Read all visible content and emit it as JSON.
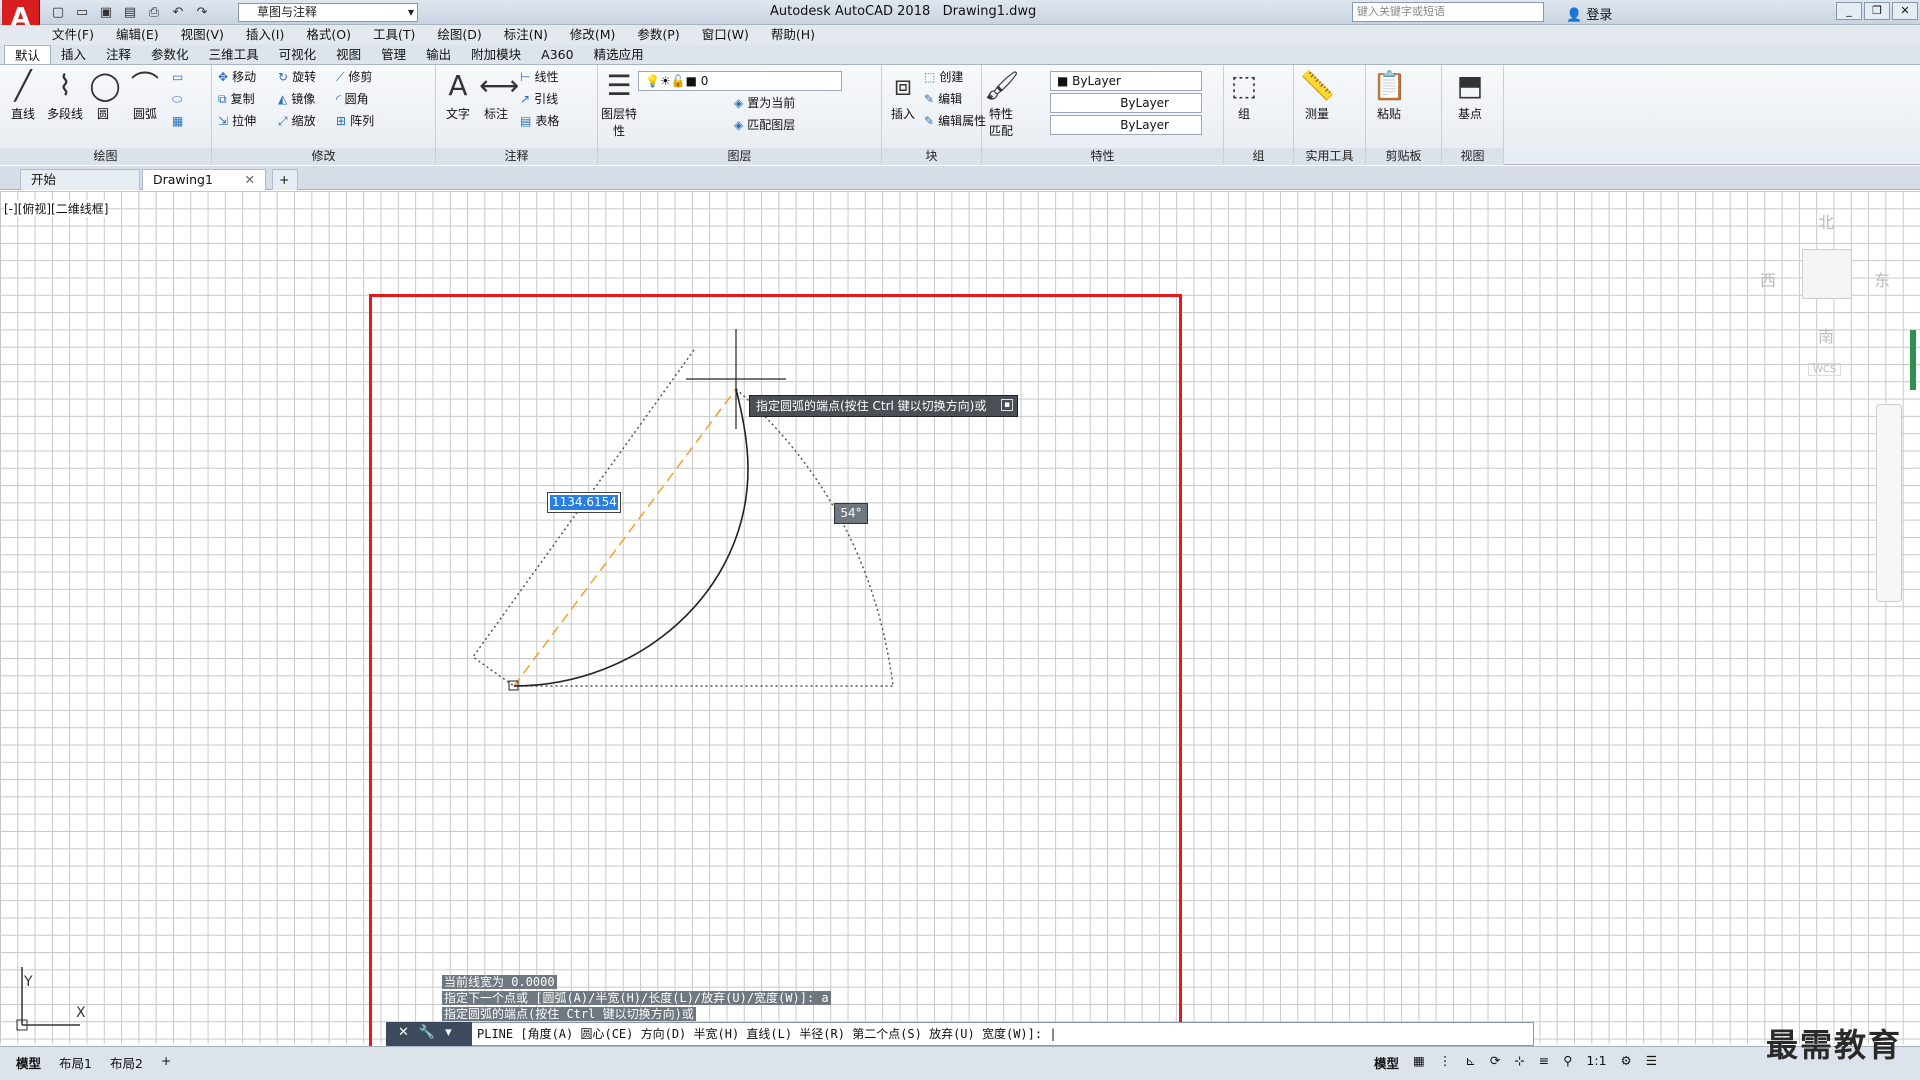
{
  "app": {
    "logo": "A",
    "title": "Autodesk AutoCAD 2018",
    "document": "Drawing1.dwg",
    "workspace": "草图与注释",
    "search_placeholder": "键入关键字或短语",
    "login": "登录"
  },
  "menu": [
    "文件(F)",
    "编辑(E)",
    "视图(V)",
    "插入(I)",
    "格式(O)",
    "工具(T)",
    "绘图(D)",
    "标注(N)",
    "修改(M)",
    "参数(P)",
    "窗口(W)",
    "帮助(H)"
  ],
  "ribbon_tabs": [
    "默认",
    "插入",
    "注释",
    "参数化",
    "三维工具",
    "可视化",
    "视图",
    "管理",
    "输出",
    "附加模块",
    "A360",
    "精选应用"
  ],
  "panels": {
    "draw": {
      "title": "绘图",
      "tools": [
        "直线",
        "多段线",
        "圆",
        "圆弧"
      ]
    },
    "modify": {
      "title": "修改",
      "tools": [
        "移动",
        "旋转",
        "修剪",
        "复制",
        "镜像",
        "圆角",
        "拉伸",
        "缩放",
        "阵列"
      ]
    },
    "annotation": {
      "title": "注释",
      "tools": [
        "文字",
        "标注",
        "线性",
        "引线",
        "表格"
      ]
    },
    "layers": {
      "title": "图层",
      "tools": [
        "图层特性",
        "置为当前",
        "匹配图层"
      ],
      "current": "0"
    },
    "block": {
      "title": "块",
      "tools": [
        "插入",
        "创建",
        "编辑",
        "编辑属性"
      ]
    },
    "properties": {
      "title": "特性",
      "match": "特性匹配",
      "color": "ByLayer",
      "linetype": "ByLayer",
      "lineweight": "ByLayer"
    },
    "groups": {
      "title": "组",
      "tool": "组"
    },
    "utilities": {
      "title": "实用工具",
      "tool": "测量"
    },
    "clipboard": {
      "title": "剪贴板",
      "tool": "粘贴"
    },
    "view": {
      "title": "视图",
      "tool": "基点"
    }
  },
  "doc_tabs": [
    "开始",
    "Drawing1"
  ],
  "viewport_label": "[-][俯视][二维线框]",
  "viewcube": {
    "north": "北",
    "south": "南",
    "east": "东",
    "west": "西",
    "wcs": "WCS"
  },
  "tooltip": "指定圆弧的端点(按住 Ctrl 键以切换方向)或",
  "dynamic_input": "1134.6154",
  "angle_label": "54°",
  "command_history": [
    "当前线宽为 0.0000",
    "指定下一个点或 [圆弧(A)/半宽(H)/长度(L)/放弃(U)/宽度(W)]: a",
    "指定圆弧的端点(按住 Ctrl 键以切换方向)或"
  ],
  "command_prompt": "PLINE [角度(A) 圆心(CE) 方向(D) 半宽(H) 直线(L) 半径(R) 第二个点(S) 放弃(U) 宽度(W)]:",
  "layout_tabs": [
    "模型",
    "布局1",
    "布局2"
  ],
  "status": {
    "model": "模型",
    "scale": "1:1"
  },
  "ucs": {
    "x": "X",
    "y": "Y"
  },
  "watermark": "最需教育"
}
